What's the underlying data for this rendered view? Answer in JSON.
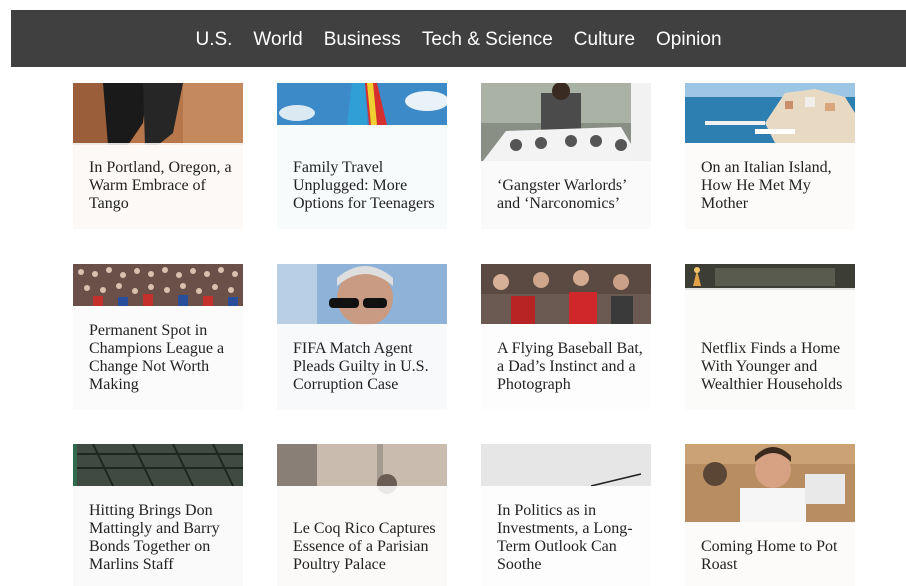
{
  "nav": {
    "items": [
      "U.S.",
      "World",
      "Business",
      "Tech & Science",
      "Culture",
      "Opinion"
    ]
  },
  "colors": {
    "nav_background": "#404040",
    "nav_text": "#ffffff",
    "title_text": "#222222"
  },
  "articles": [
    {
      "title": "In Portland, Oregon, a Warm Embrace of Tango"
    },
    {
      "title": "Family Travel Unplugged: More Options for Teenagers"
    },
    {
      "title": "‘Gangster Warlords’ and ‘Narconomics’"
    },
    {
      "title": "On an Italian Island, How He Met My Mother"
    },
    {
      "title": "Permanent Spot in Champions League a Change Not Worth Making"
    },
    {
      "title": "FIFA Match Agent Pleads Guilty in U.S. Corruption Case"
    },
    {
      "title": "A Flying Baseball Bat, a Dad’s Instinct and a Photograph"
    },
    {
      "title": "Netflix Finds a Home With Younger and Wealthier Households"
    },
    {
      "title": "Hitting Brings Don Mattingly and Barry Bonds Together on Marlins Staff"
    },
    {
      "title": "Le Coq Rico Captures Essence of a Parisian Poultry Palace"
    },
    {
      "title": "In Politics as in Investments, a Long-Term Outlook Can Soothe"
    },
    {
      "title": "Coming Home to Pot Roast"
    }
  ]
}
